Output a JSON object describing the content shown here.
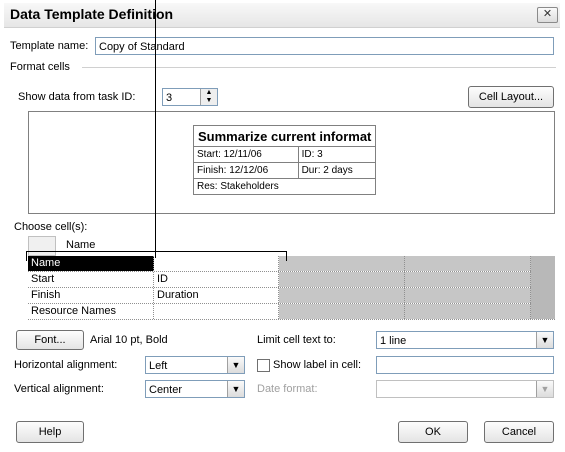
{
  "window": {
    "title": "Data Template Definition",
    "close_icon": "close-icon"
  },
  "template_name": {
    "label": "Template name:",
    "value": "Copy of Standard"
  },
  "format_cells": {
    "group_label": "Format cells",
    "show_data_label": "Show data from task ID:",
    "task_id_value": "3",
    "cell_layout_button": "Cell Layout..."
  },
  "preview": {
    "title": "Summarize current informat",
    "rows": [
      [
        "Start: 12/11/06",
        "ID: 3"
      ],
      [
        "Finish: 12/12/06",
        "Dur: 2 days"
      ],
      [
        "Res: Stakeholders"
      ]
    ]
  },
  "choose_cells": {
    "label": "Choose cell(s):",
    "column_header": "Name",
    "rows": [
      [
        "Name",
        "",
        "",
        ""
      ],
      [
        "Start",
        "ID",
        "",
        ""
      ],
      [
        "Finish",
        "Duration",
        "",
        ""
      ],
      [
        "Resource Names",
        "",
        "",
        ""
      ]
    ]
  },
  "font": {
    "button": "Font...",
    "description": "Arial 10 pt, Bold"
  },
  "limit_text": {
    "label": "Limit cell text to:",
    "value": "1 line"
  },
  "horizontal_alignment": {
    "label": "Horizontal alignment:",
    "value": "Left"
  },
  "show_label": {
    "label": "Show label in cell:",
    "checked": false,
    "value": ""
  },
  "vertical_alignment": {
    "label": "Vertical alignment:",
    "value": "Center"
  },
  "date_format": {
    "label": "Date format:",
    "value": ""
  },
  "buttons": {
    "help": "Help",
    "ok": "OK",
    "cancel": "Cancel"
  }
}
